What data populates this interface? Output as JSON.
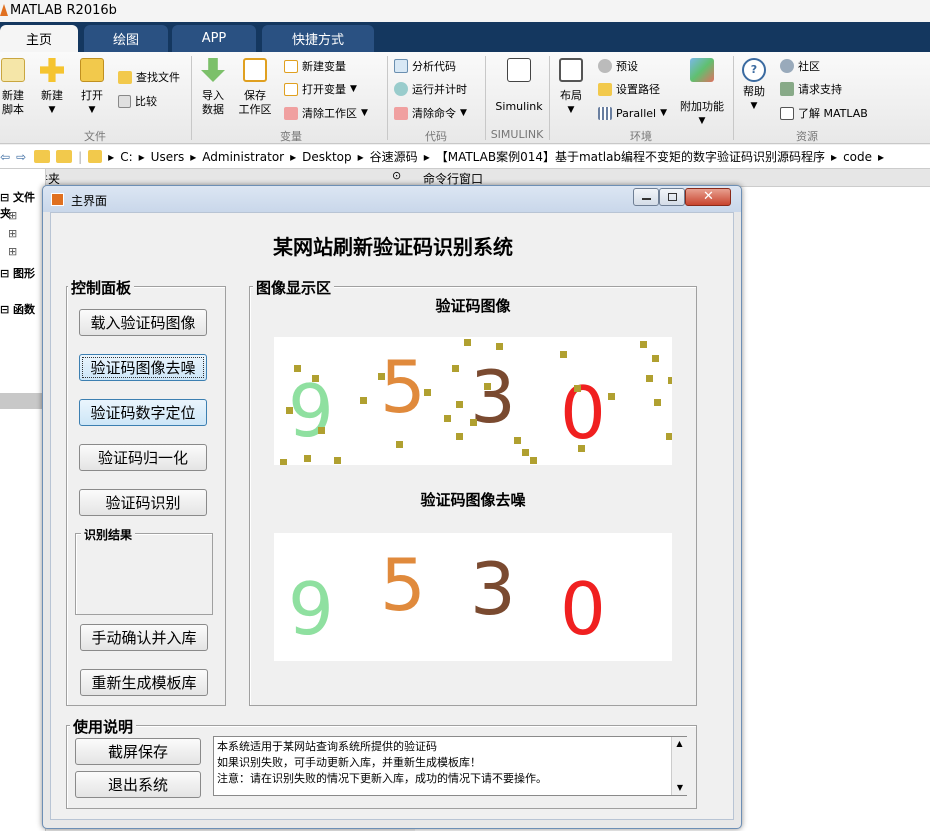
{
  "app": {
    "title": "MATLAB R2016b"
  },
  "tabs": [
    {
      "label": "主页",
      "active": true
    },
    {
      "label": "绘图",
      "active": false
    },
    {
      "label": "APP",
      "active": false
    },
    {
      "label": "快捷方式",
      "active": false
    }
  ],
  "ribbon": {
    "file": {
      "new_script": "新建\n脚本",
      "new": "新建",
      "open": "打开",
      "find_files": "查找文件",
      "compare": "比较",
      "group": "文件"
    },
    "variable": {
      "import": "导入\n数据",
      "save_ws": "保存\n工作区",
      "new_var": "新建变量",
      "open_var": "打开变量",
      "clear_ws": "清除工作区",
      "group": "变量"
    },
    "code": {
      "analyze": "分析代码",
      "run_timing": "运行并计时",
      "clear_cmds": "清除命令",
      "group": "代码"
    },
    "simulink": {
      "label": "Simulink",
      "group": "SIMULINK"
    },
    "env": {
      "layout": "布局",
      "prefs": "预设",
      "set_path": "设置路径",
      "parallel": "Parallel",
      "addons": "附加功能",
      "group": "环境"
    },
    "resources": {
      "help": "帮助",
      "community": "社区",
      "support": "请求支持",
      "learn": "了解 MATLAB",
      "group": "资源"
    }
  },
  "address": {
    "path": [
      "C:",
      "Users",
      "Administrator",
      "Desktop",
      "谷速源码",
      "【MATLAB案例014】基于matlab编程不变矩的数字验证码识别源码程序",
      "code"
    ]
  },
  "panels": {
    "current_folder": "当前文件夹",
    "command_window": "命令行窗口",
    "tree": [
      {
        "label": "文件夹"
      },
      {
        "label": "图形"
      },
      {
        "label": "函数"
      }
    ]
  },
  "gui": {
    "window_title": "主界面",
    "heading": "某网站刷新验证码识别系统",
    "control_panel": {
      "label": "控制面板",
      "buttons": [
        "载入验证码图像",
        "验证码图像去噪",
        "验证码数字定位",
        "验证码归一化",
        "验证码识别"
      ],
      "result_label": "识别结果",
      "result_value": "",
      "manual_button": "手动确认并入库",
      "regen_button": "重新生成模板库"
    },
    "display": {
      "label": "图像显示区",
      "image1_title": "验证码图像",
      "image2_title": "验证码图像去噪",
      "digits": [
        "9",
        "5",
        "3",
        "0"
      ],
      "digit_colors": [
        "#8fe0a0",
        "#e08a3c",
        "#7a4a30",
        "#f02020"
      ]
    },
    "usage": {
      "label": "使用说明",
      "screenshot_button": "截屏保存",
      "exit_button": "退出系统",
      "text": "本系统适用于某网站查询系统所提供的验证码\n如果识别失败，可手动更新入库，并重新生成模板库！\n注意：请在识别失败的情况下更新入库，成功的情况下请不要操作。"
    }
  }
}
